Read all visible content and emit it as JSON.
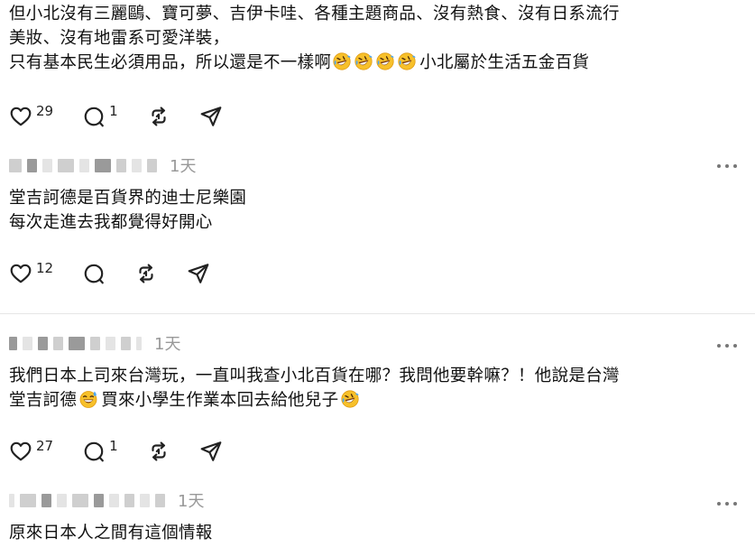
{
  "post0": {
    "lines": [
      "但小北沒有三麗鷗、寶可夢、吉伊卡哇、各種主題商品、沒有熱食、沒有日系流行",
      "美妝、沒有地雷系可愛洋裝，",
      "只有基本民生必須用品，所以還是不一樣啊",
      "小北屬於生活五金百貨"
    ],
    "emoji_name": "rolling-on-floor-laughing",
    "likes": "29",
    "comments": "1"
  },
  "post1": {
    "time": "1天",
    "lines": [
      "堂吉訶德是百貨界的迪士尼樂園",
      "每次走進去我都覺得好開心"
    ],
    "likes": "12",
    "comments": ""
  },
  "post2": {
    "time": "1天",
    "lines": [
      "我們日本上司來台灣玩，一直叫我查小北百貨在哪？我問他要幹嘛？！他說是台灣",
      "堂吉訶德",
      "買來小學生作業本回去給他兒子"
    ],
    "emoji1_name": "grinning-sweat",
    "emoji2_name": "rolling-on-floor-laughing",
    "likes": "27",
    "comments": "1"
  },
  "post3": {
    "time": "1天",
    "lines": [
      "原來日本人之間有這個情報"
    ]
  },
  "colors": {
    "text": "#101010",
    "muted": "#999999",
    "divider": "#e6e6e6",
    "emoji": "#f7c02a"
  },
  "icons": [
    "heart-icon",
    "comment-icon",
    "repost-icon",
    "share-icon",
    "more-icon"
  ]
}
